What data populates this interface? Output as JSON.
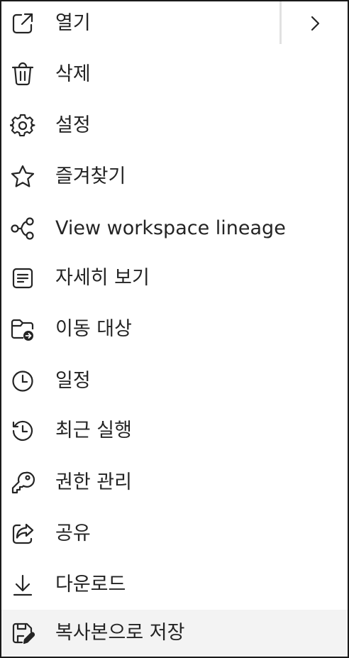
{
  "menu": {
    "items": [
      {
        "label": "열기",
        "icon": "open-external-icon"
      },
      {
        "label": "삭제",
        "icon": "trash-icon"
      },
      {
        "label": "설정",
        "icon": "gear-icon"
      },
      {
        "label": "즐겨찾기",
        "icon": "star-icon"
      },
      {
        "label": "View workspace lineage",
        "icon": "lineage-icon"
      },
      {
        "label": "자세히 보기",
        "icon": "details-icon"
      },
      {
        "label": "이동 대상",
        "icon": "folder-move-icon"
      },
      {
        "label": "일정",
        "icon": "clock-icon"
      },
      {
        "label": "최근 실행",
        "icon": "history-icon"
      },
      {
        "label": "권한 관리",
        "icon": "key-icon"
      },
      {
        "label": "공유",
        "icon": "share-icon"
      },
      {
        "label": "다운로드",
        "icon": "download-icon"
      },
      {
        "label": "복사본으로 저장",
        "icon": "save-copy-icon"
      }
    ],
    "submenu_icon": "chevron-right-icon",
    "hover_color": "#f3f3f3",
    "icon_color": "#242424"
  }
}
